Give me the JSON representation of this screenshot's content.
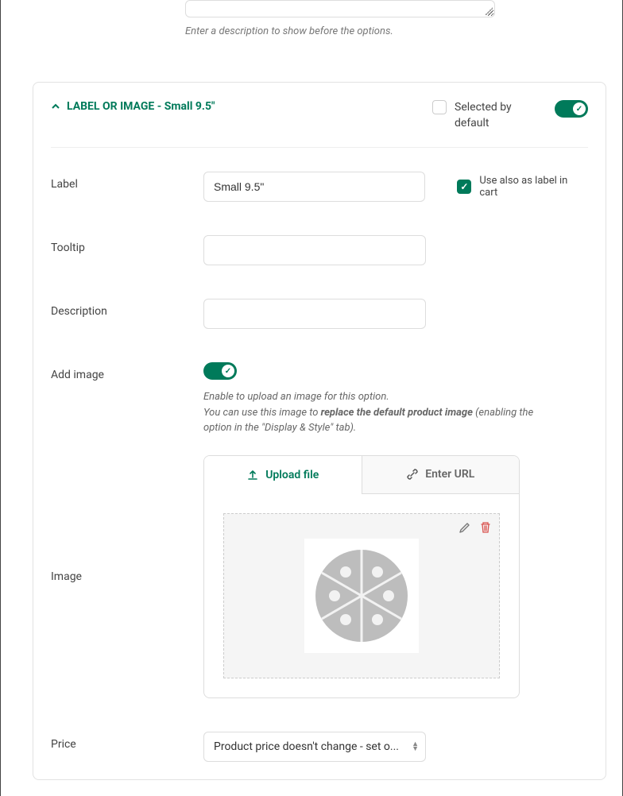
{
  "top_hint": "Enter a description to show before the options.",
  "panel": {
    "title_prefix": "LABEL OR IMAGE",
    "title_suffix": "Small 9.5\"",
    "selected_by_default_label": "Selected by default",
    "selected_by_default_checked": false,
    "panel_toggle_on": true
  },
  "fields": {
    "label": {
      "label": "Label",
      "value": "Small 9.5\"",
      "cart_checkbox_label": "Use also as label in cart",
      "cart_checkbox_checked": true
    },
    "tooltip": {
      "label": "Tooltip",
      "value": ""
    },
    "description": {
      "label": "Description",
      "value": ""
    },
    "add_image": {
      "label": "Add image",
      "toggle_on": true,
      "hint_line1": "Enable to upload an image for this option.",
      "hint_line2a": "You can use this image to ",
      "hint_line2b": "replace the default product image",
      "hint_line2c": " (enabling the option in the \"Display & Style\" tab)."
    },
    "image": {
      "label": "Image",
      "tab_upload": "Upload file",
      "tab_url": "Enter URL"
    },
    "price": {
      "label": "Price",
      "selected": "Product price doesn't change - set o..."
    }
  }
}
